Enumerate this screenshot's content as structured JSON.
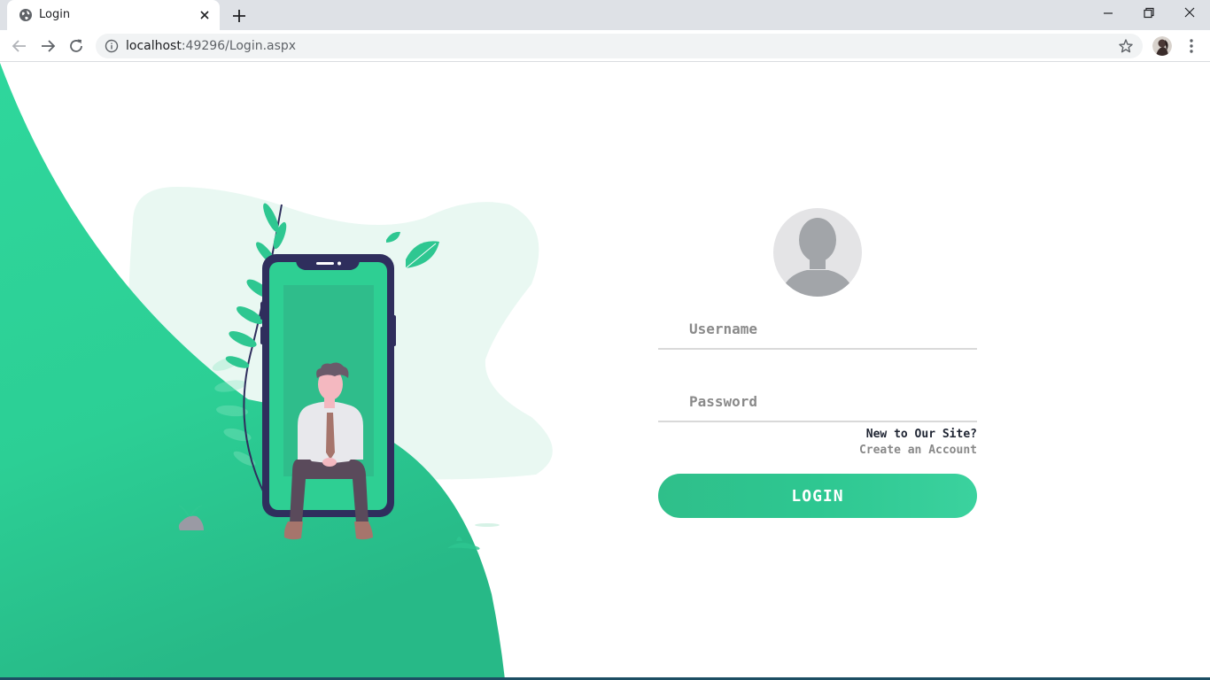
{
  "browser": {
    "tab_title": "Login",
    "url_host": "localhost",
    "url_rest": ":49296/Login.aspx"
  },
  "login": {
    "username_placeholder": "Username",
    "password_placeholder": "Password",
    "signup_question": "New to Our Site?",
    "signup_link": "Create an Account",
    "login_button": "LOGIN"
  },
  "colors": {
    "brand_green": "#2ec791",
    "dark_navy": "#2f2e5d",
    "field_line": "#d9d9d9",
    "chrome_bg": "#dee1e6"
  },
  "icons": [
    "globe-icon",
    "close-icon",
    "plus-icon",
    "minimize-icon",
    "restore-icon",
    "window-close-icon",
    "back-arrow-icon",
    "forward-arrow-icon",
    "reload-icon",
    "info-icon",
    "star-icon",
    "profile-avatar-icon",
    "kebab-menu-icon",
    "user-avatar-icon"
  ]
}
